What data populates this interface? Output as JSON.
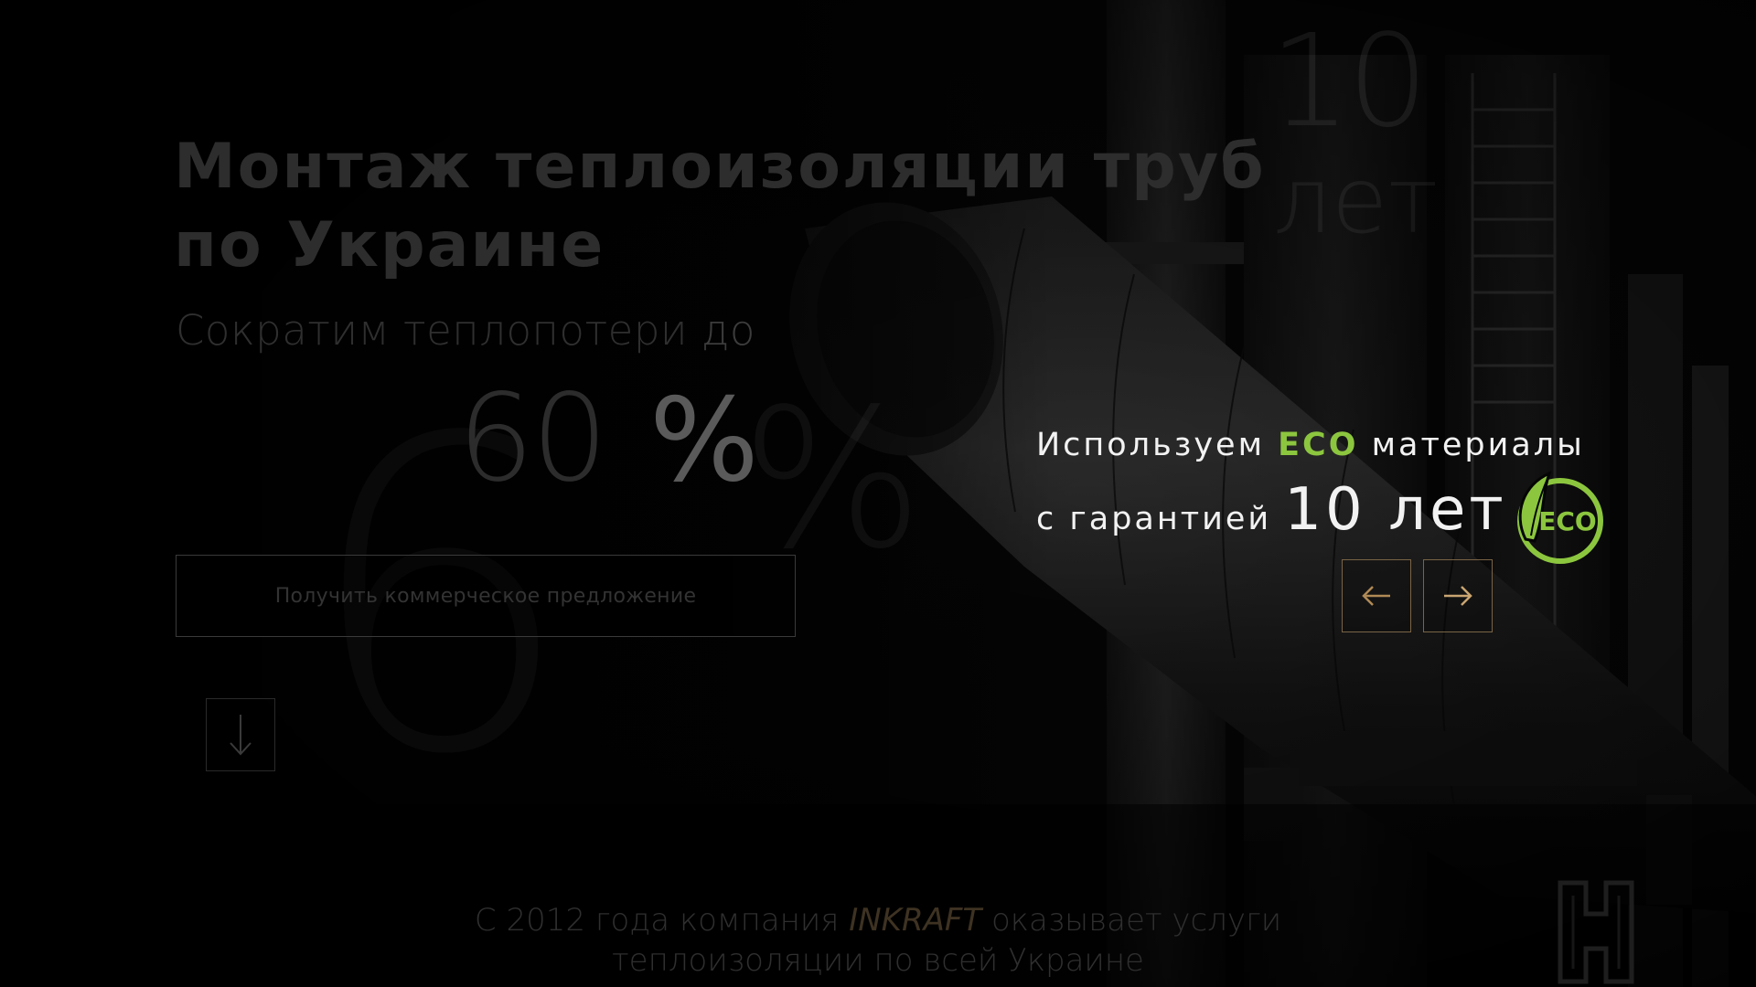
{
  "hero": {
    "title": "Монтаж теплоизоляции труб\nпо Украине",
    "subtitle": "Сократим теплопотери",
    "subtitle_tail": " до",
    "value": "60",
    "value_unit": "%",
    "cta_label": "Получить коммерческое предложение",
    "scroll_icon": "arrow-down-icon"
  },
  "ghost": {
    "big_number": "10",
    "big_word": "лет",
    "left_digit": "6",
    "pct": "%"
  },
  "slide": {
    "line1_prefix": "Используем ",
    "line1_accent": "ECO",
    "line1_suffix": " материалы",
    "line2_prefix": "с гарантией ",
    "line2_big": "10 лет",
    "badge_text": "ECO",
    "badge_icon": "eco-leaf-icon"
  },
  "navigation": {
    "prev_icon": "arrow-left-icon",
    "next_icon": "arrow-right-icon"
  },
  "about": {
    "prefix": "С 2012 года компания ",
    "brand": "INKRAFT",
    "suffix": " оказывает услуги",
    "line2": "теплоизоляции по всей Украине"
  },
  "colors": {
    "eco_green": "#8cc63f",
    "nav_border": "#7a6446",
    "background": "#050505"
  }
}
